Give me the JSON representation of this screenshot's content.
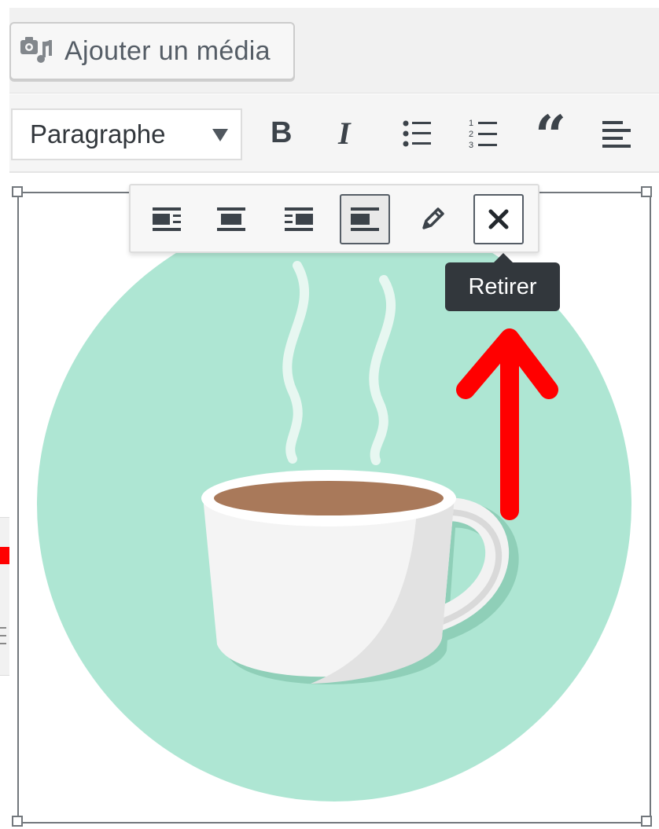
{
  "media_button": {
    "label": "Ajouter un média",
    "icon": "add-media-icon"
  },
  "format_select": {
    "value": "Paragraphe"
  },
  "toolbar_icons": [
    "bold-icon",
    "italic-icon",
    "bulleted-list-icon",
    "numbered-list-icon",
    "blockquote-icon",
    "align-left-icon"
  ],
  "toolbar": {
    "bold_label": "B",
    "italic_label": "I",
    "quote_label": "“",
    "numbered_digits": [
      "1",
      "2",
      "3"
    ]
  },
  "image_toolbar": {
    "buttons": [
      {
        "name": "align-left",
        "icon": "align-left-icon",
        "active": false
      },
      {
        "name": "align-center",
        "icon": "align-center-icon",
        "active": false
      },
      {
        "name": "align-right",
        "icon": "align-right-icon",
        "active": false
      },
      {
        "name": "align-none",
        "icon": "align-none-icon",
        "active": true
      },
      {
        "name": "edit",
        "icon": "pencil-icon",
        "active": false
      },
      {
        "name": "remove",
        "icon": "close-icon",
        "active": false
      }
    ],
    "tooltip": "Retirer"
  },
  "image": {
    "subject": "coffee cup",
    "circle_color": "#aee6d3",
    "coffee_color": "#a9795a"
  },
  "colors": {
    "annotation_red": "#ff0000",
    "tooltip_bg": "#32373c"
  }
}
